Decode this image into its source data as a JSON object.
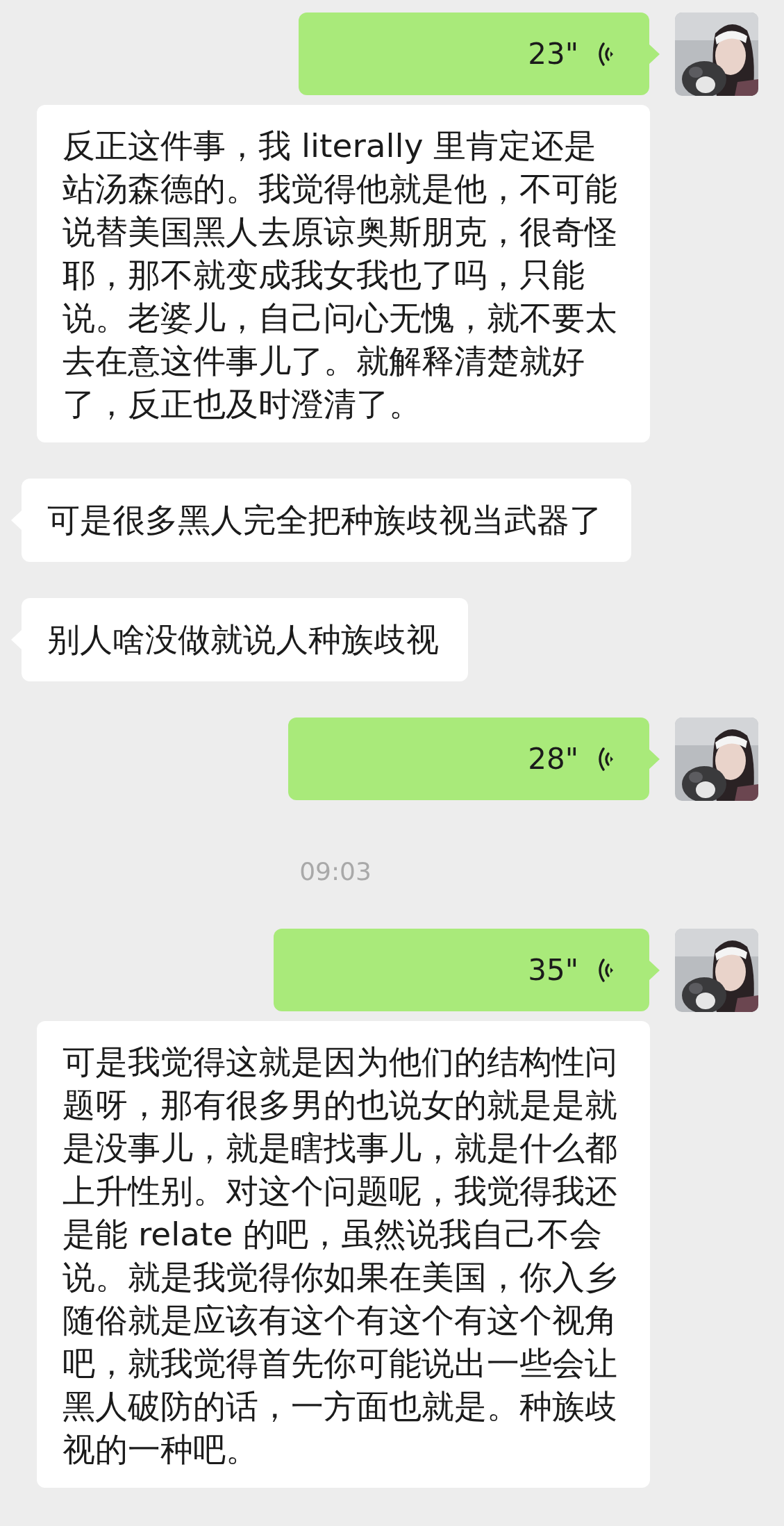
{
  "messages": [
    {
      "kind": "voice",
      "outgoing": true,
      "duration": "23\""
    },
    {
      "kind": "transcript",
      "outgoing": true,
      "text": "反正这件事，我 literally 里肯定还是站汤森德的。我觉得他就是他，不可能说替美国黑人去原谅奥斯朋克，很奇怪耶，那不就变成我女我也了吗，只能说。老婆儿，自己问心无愧，就不要太去在意这件事儿了。就解释清楚就好了，反正也及时澄清了。"
    },
    {
      "kind": "text",
      "outgoing": false,
      "text": "可是很多黑人完全把种族歧视当武器了"
    },
    {
      "kind": "text",
      "outgoing": false,
      "text": "别人啥没做就说人种族歧视"
    },
    {
      "kind": "voice",
      "outgoing": true,
      "duration": "28\""
    },
    {
      "kind": "time",
      "text": "09:03"
    },
    {
      "kind": "voice",
      "outgoing": true,
      "duration": "35\""
    },
    {
      "kind": "transcript",
      "outgoing": true,
      "text": "可是我觉得这就是因为他们的结构性问题呀，那有很多男的也说女的就是是就是没事儿，就是瞎找事儿，就是什么都上升性别。对这个问题呢，我觉得我还是能 relate 的吧，虽然说我自己不会说。就是我觉得你如果在美国，你入乡随俗就是应该有这个有这个有这个视角吧，就我觉得首先你可能说出一些会让黑人破防的话，一方面也就是。种族歧视的一种吧。"
    }
  ]
}
